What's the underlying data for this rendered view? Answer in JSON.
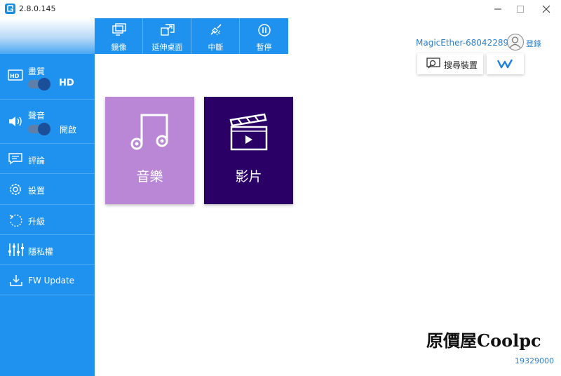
{
  "titlebar": {
    "version": "2.8.0.145"
  },
  "toolbar": {
    "items": [
      {
        "label": "鏡像",
        "icon": "mirror-icon"
      },
      {
        "label": "延伸桌面",
        "icon": "extend-desktop-icon"
      },
      {
        "label": "中斷",
        "icon": "disconnect-icon"
      },
      {
        "label": "暫停",
        "icon": "pause-icon"
      }
    ]
  },
  "sidebar": {
    "quality": {
      "label": "畫質",
      "value": "HD",
      "icon": "hd-icon"
    },
    "sound": {
      "label": "聲音",
      "value": "開啟",
      "icon": "speaker-icon"
    },
    "items": [
      {
        "label": "評論",
        "icon": "comment-icon"
      },
      {
        "label": "設置",
        "icon": "gear-icon"
      },
      {
        "label": "升級",
        "icon": "upgrade-icon"
      },
      {
        "label": "隱私權",
        "icon": "sliders-icon"
      },
      {
        "label": "FW Update",
        "icon": "download-icon"
      }
    ]
  },
  "header": {
    "user_name": "MagicEther-68042289",
    "login_label": "登錄",
    "search_device_label": "搜尋裝置"
  },
  "tiles": [
    {
      "label": "音樂",
      "icon": "music-note-icon",
      "color": "#b987d6"
    },
    {
      "label": "影片",
      "icon": "clapperboard-icon",
      "color": "#2a0066"
    }
  ],
  "watermark": {
    "text": "原價屋Coolpc",
    "number": "19329000"
  },
  "colors": {
    "accent": "#1e92ee",
    "link": "#2a7fcb"
  }
}
